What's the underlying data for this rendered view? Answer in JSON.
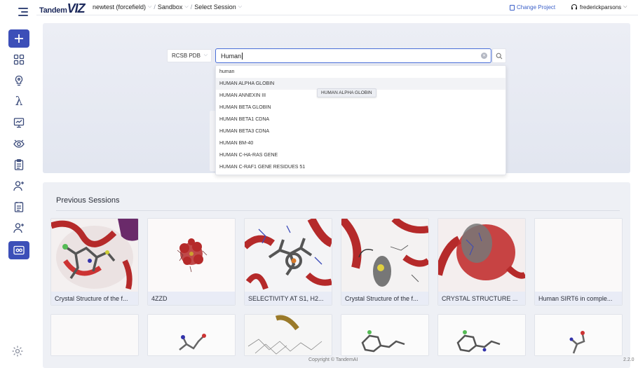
{
  "header": {
    "logo_t": "Tandem",
    "logo_v": "VIZ",
    "crumbs": [
      {
        "label": "newtest (forcefield)"
      },
      {
        "label": "Sandbox"
      },
      {
        "label": "Select Session"
      }
    ],
    "change_project": "Change Project",
    "user": "frederickparsons"
  },
  "sidebar": {
    "items": [
      {
        "icon": "plus-icon"
      },
      {
        "icon": "grid-icon"
      },
      {
        "icon": "lightbulb-icon"
      },
      {
        "icon": "lambda-icon"
      },
      {
        "icon": "presentation-icon"
      },
      {
        "icon": "eye-icon"
      },
      {
        "icon": "clipboard-icon"
      },
      {
        "icon": "user-add-icon"
      },
      {
        "icon": "document-icon"
      },
      {
        "icon": "user-add-icon"
      },
      {
        "icon": "viewer-icon"
      }
    ],
    "lambda": "λ"
  },
  "search": {
    "source": "RCSB PDB",
    "query": "Human",
    "options": [
      "human",
      "HUMAN ALPHA GLOBIN",
      "HUMAN ANNEXIN III",
      "HUMAN BETA GLOBIN",
      "HUMAN BETA1 CDNA",
      "HUMAN BETA3 CDNA",
      "HUMAN BM-40",
      "HUMAN C-HA-RAS GENE",
      "HUMAN C-RAF1 GENE RESIDUES 51"
    ],
    "tooltip": "HUMAN ALPHA GLOBIN"
  },
  "sessions": {
    "title": "Previous Sessions",
    "cards": [
      {
        "label": "Crystal Structure of the f..."
      },
      {
        "label": "4ZZD"
      },
      {
        "label": "SELECTIVITY AT S1, H2..."
      },
      {
        "label": "Crystal Structure of the f..."
      },
      {
        "label": "CRYSTAL STRUCTURE ..."
      },
      {
        "label": "Human SIRT6 in comple..."
      }
    ]
  },
  "footer": {
    "copyright": "Copyright © TandemAI",
    "version": "2.2.0"
  },
  "colors": {
    "accent": "#3c4fb8",
    "link": "#3a5fc8",
    "protein_red": "#b52a2a"
  }
}
